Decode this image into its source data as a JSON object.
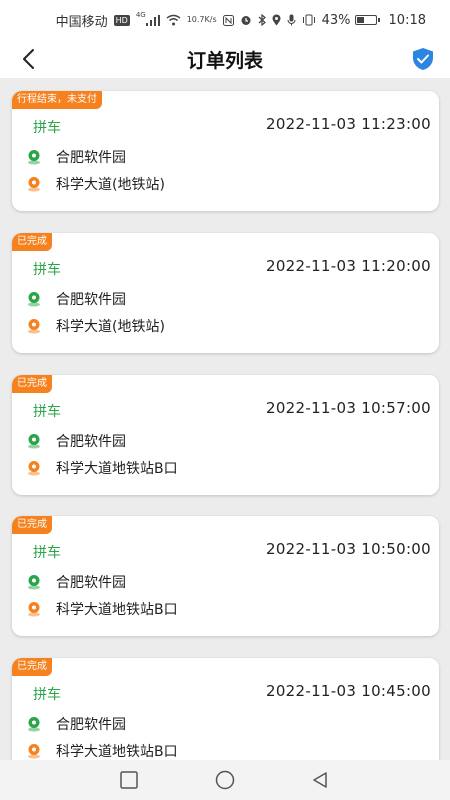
{
  "status_bar": {
    "carrier": "中国移动",
    "hd": "HD",
    "net_type": "4G",
    "speed_value": "10.7",
    "speed_unit": "K/s",
    "battery": "43%",
    "battery_level": 0.43,
    "time": "10:18"
  },
  "header": {
    "title": "订单列表"
  },
  "orders": [
    {
      "status": "行程结束，未支付",
      "type": "拼车",
      "time": "2022-11-03 11:23:00",
      "start": "合肥软件园",
      "end": "科学大道(地铁站)"
    },
    {
      "status": "已完成",
      "type": "拼车",
      "time": "2022-11-03 11:20:00",
      "start": "合肥软件园",
      "end": "科学大道(地铁站)"
    },
    {
      "status": "已完成",
      "type": "拼车",
      "time": "2022-11-03 10:57:00",
      "start": "合肥软件园",
      "end": "科学大道地铁站B口"
    },
    {
      "status": "已完成",
      "type": "拼车",
      "time": "2022-11-03 10:50:00",
      "start": "合肥软件园",
      "end": "科学大道地铁站B口"
    },
    {
      "status": "已完成",
      "type": "拼车",
      "time": "2022-11-03 10:45:00",
      "start": "合肥软件园",
      "end": "科学大道地铁站B口"
    }
  ],
  "colors": {
    "badge": "#f5811f",
    "type_text": "#2aa54a",
    "start_icon": "#2aa54a",
    "end_icon": "#f5811f",
    "shield": "#2a86e0"
  }
}
